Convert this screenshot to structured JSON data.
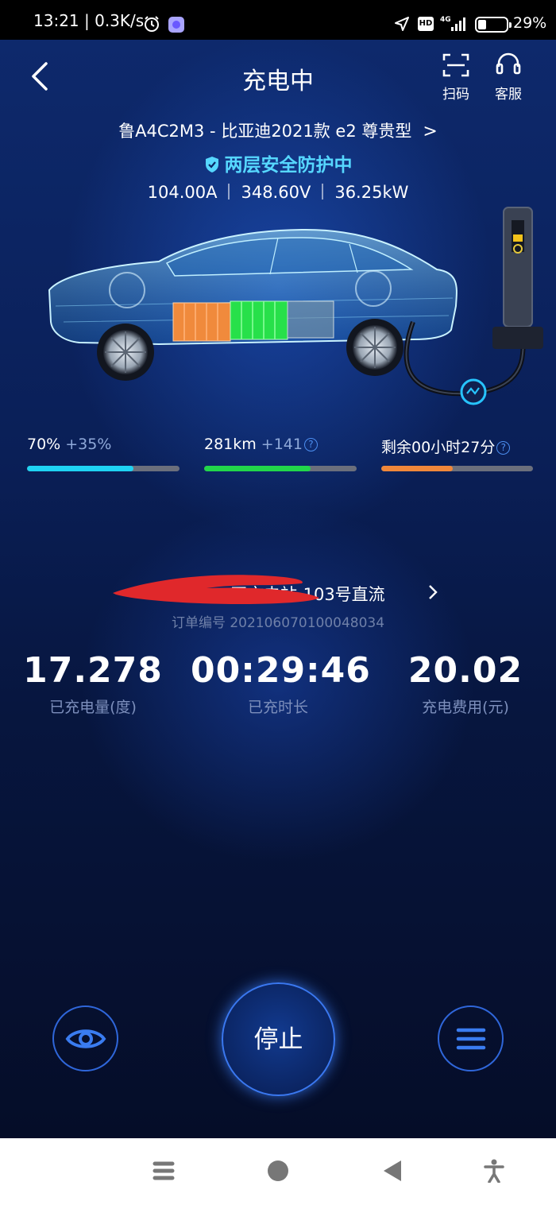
{
  "status_bar": {
    "time": "13:21 | 0.3K/s",
    "hd_badge": "HD",
    "battery_percent": "29%",
    "battery_level": 0.29,
    "icons": [
      "alarm-icon",
      "app-icon",
      "location-arrow-icon",
      "hd-icon",
      "signal-4g-icon",
      "battery-icon"
    ]
  },
  "header": {
    "title": "充电中",
    "scan_label": "扫码",
    "service_label": "客服"
  },
  "car": {
    "info": "鲁A4C2M3 - 比亚迪2021款 e2 尊贵型",
    "safety_text": "两层安全防护中",
    "current": "104.00A",
    "voltage": "348.60V",
    "power": "36.25kW"
  },
  "progress": {
    "soc": {
      "value": "70%",
      "delta": "+35%",
      "fraction": 0.7,
      "color": "#1fd3f2"
    },
    "range": {
      "value": "281km",
      "delta": "+141",
      "fraction": 0.7,
      "color": "#22d64a"
    },
    "remaining": {
      "value": "剩余00小时27分",
      "fraction": 0.47,
      "color": "#f0873a"
    }
  },
  "station": {
    "name": "...区充电站-103号直流",
    "order_no": "订单编号 202106070100048034"
  },
  "stats": {
    "energy": {
      "value": "17.278",
      "caption": "已充电量(度)"
    },
    "duration": {
      "value": "00:29:46",
      "caption": "已充时长"
    },
    "cost": {
      "value": "20.02",
      "caption": "充电费用(元)"
    }
  },
  "actions": {
    "stop_label": "停止"
  },
  "colors": {
    "accent": "#2f66d9",
    "safety": "#56d7ff",
    "redaction": "#e0282b"
  }
}
